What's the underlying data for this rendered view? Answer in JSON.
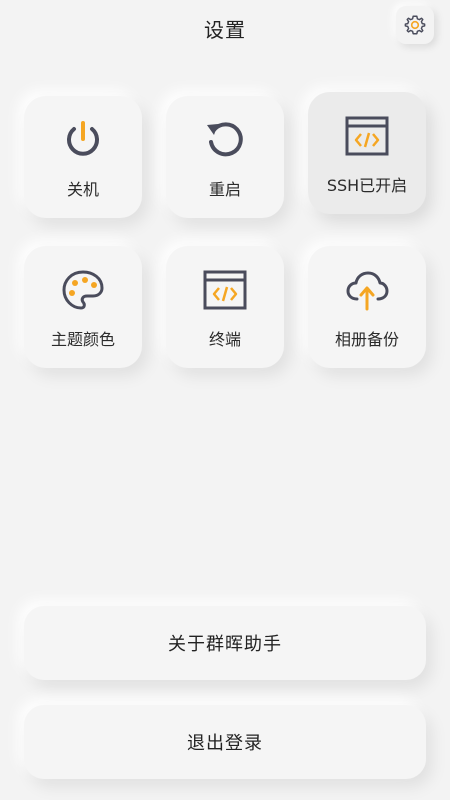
{
  "header": {
    "title": "设置",
    "settings_icon": "gear-icon"
  },
  "colors": {
    "accent": "#f5a623",
    "icon_dark": "#4a4c5c",
    "background": "#f3f3f3"
  },
  "tiles": [
    {
      "label": "关机",
      "icon": "power-icon",
      "active": false
    },
    {
      "label": "重启",
      "icon": "restart-icon",
      "active": false
    },
    {
      "label": "SSH已开启",
      "icon": "code-window-icon",
      "active": true
    },
    {
      "label": "主题颜色",
      "icon": "palette-icon",
      "active": false
    },
    {
      "label": "终端",
      "icon": "terminal-icon",
      "active": false
    },
    {
      "label": "相册备份",
      "icon": "cloud-upload-icon",
      "active": false
    }
  ],
  "actions": {
    "about": "关于群晖助手",
    "logout": "退出登录"
  }
}
